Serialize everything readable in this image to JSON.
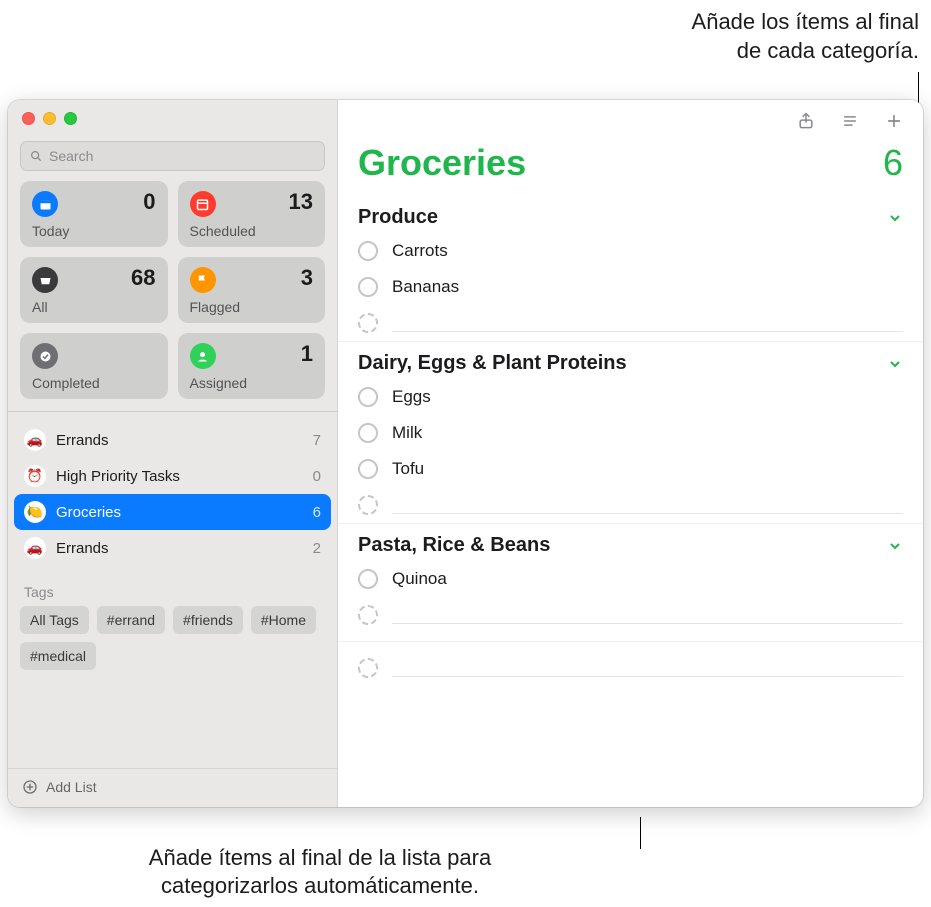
{
  "callouts": {
    "top_line1": "Añade los ítems al final",
    "top_line2": "de cada categoría.",
    "bottom_line1": "Añade ítems al final de la lista para",
    "bottom_line2": "categorizarlos automáticamente."
  },
  "sidebar": {
    "search_placeholder": "Search",
    "smart": [
      {
        "label": "Today",
        "count": 0,
        "color": "#0a7aff"
      },
      {
        "label": "Scheduled",
        "count": 13,
        "color": "#ff3b30"
      },
      {
        "label": "All",
        "count": 68,
        "color": "#3a3a3c"
      },
      {
        "label": "Flagged",
        "count": 3,
        "color": "#ff9500"
      },
      {
        "label": "Completed",
        "count": "",
        "color": "#6e6e73"
      },
      {
        "label": "Assigned",
        "count": 1,
        "color": "#30d158"
      }
    ],
    "lists": [
      {
        "name": "Errands",
        "count": 7,
        "emoji": "🚗",
        "selected": false
      },
      {
        "name": "High Priority Tasks",
        "count": 0,
        "emoji": "⏰",
        "selected": false
      },
      {
        "name": "Groceries",
        "count": 6,
        "emoji": "🍋",
        "selected": true
      },
      {
        "name": "Errands",
        "count": 2,
        "emoji": "🚗",
        "selected": false
      }
    ],
    "tags_title": "Tags",
    "tags": [
      "All Tags",
      "#errand",
      "#friends",
      "#Home",
      "#medical"
    ],
    "add_list_label": "Add List"
  },
  "main": {
    "title": "Groceries",
    "total": 6,
    "sections": [
      {
        "title": "Produce",
        "items": [
          "Carrots",
          "Bananas"
        ]
      },
      {
        "title": "Dairy, Eggs & Plant Proteins",
        "items": [
          "Eggs",
          "Milk",
          "Tofu"
        ]
      },
      {
        "title": "Pasta, Rice & Beans",
        "items": [
          "Quinoa"
        ]
      }
    ]
  }
}
